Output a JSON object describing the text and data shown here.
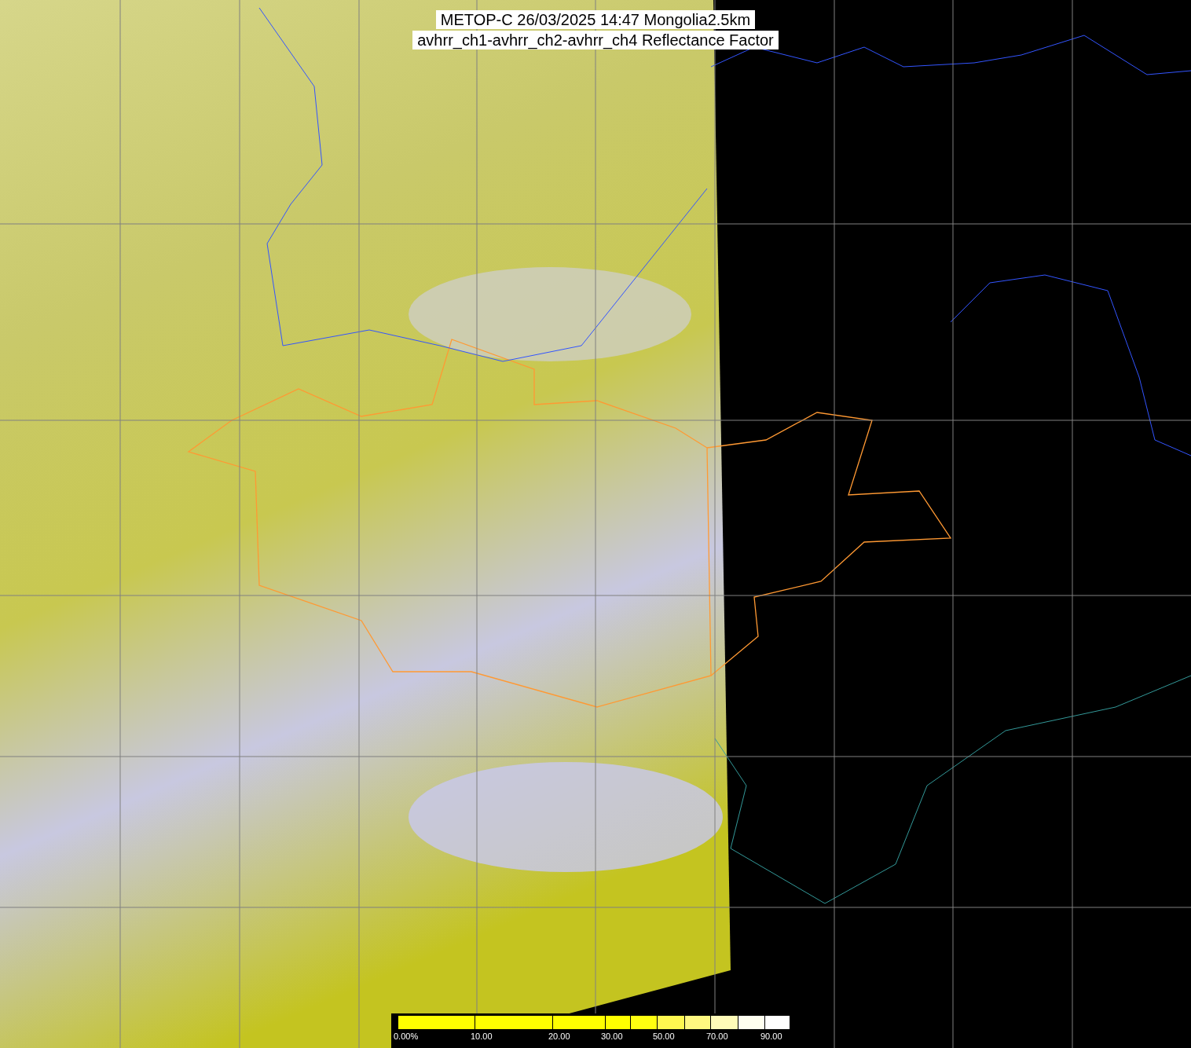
{
  "title": {
    "lines": [
      "METOP-C 26/03/2025 14:47 Mongolia2.5km",
      "avhrr_ch1-avhrr_ch2-avhrr_ch4 Reflectance Factor"
    ]
  },
  "colorbar": {
    "segments": [
      {
        "color": "#ffff00",
        "label": "0.00%"
      },
      {
        "color": "#ffff00",
        "label": "10.00"
      },
      {
        "color": "#ffff00",
        "label": "20.00"
      },
      {
        "color": "#ffff00",
        "label": "30.00"
      },
      {
        "color": "#ffff10"
      },
      {
        "color": "#fff850",
        "label": "50.00"
      },
      {
        "color": "#fff880"
      },
      {
        "color": "#fffbb8",
        "label": "70.00"
      },
      {
        "color": "#fffff0"
      },
      {
        "color": "#ffffff",
        "label": "90.00"
      }
    ]
  }
}
